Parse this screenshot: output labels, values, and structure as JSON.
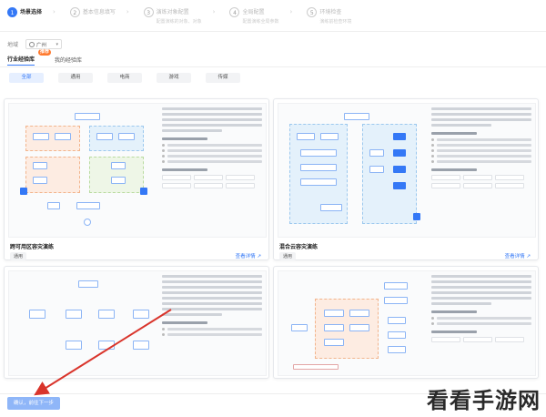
{
  "stepper": {
    "steps": [
      {
        "num": "1",
        "title": "场景选择",
        "sub": ""
      },
      {
        "num": "2",
        "title": "基本信息填写",
        "sub": ""
      },
      {
        "num": "3",
        "title": "演练对象配置",
        "sub": "配置演练的对象、对象"
      },
      {
        "num": "4",
        "title": "全局配置",
        "sub": "配置演练全局参数"
      },
      {
        "num": "5",
        "title": "环境检查",
        "sub": "演练前检查环境"
      }
    ]
  },
  "region": {
    "label": "地域",
    "value": "广州"
  },
  "tabs": [
    {
      "label": "行业经验库",
      "badge": "推荐"
    },
    {
      "label": "我的经验库",
      "badge": ""
    }
  ],
  "filters": [
    "全部",
    "通用",
    "电商",
    "游戏",
    "传媒"
  ],
  "cards": [
    {
      "title": "跨可用区容灾演练",
      "tag": "通用",
      "link": "查看详情"
    },
    {
      "title": "混合云容灾演练",
      "tag": "通用",
      "link": "查看详情"
    },
    {
      "title": "",
      "tag": "",
      "link": ""
    },
    {
      "title": "",
      "tag": "",
      "link": ""
    }
  ],
  "next_button": "确认，前往下一步",
  "watermark": "看看手游网",
  "colors": {
    "accent": "#3478f6",
    "annotation_arrow": "#d9342b",
    "badge": "#ff7a2f"
  }
}
